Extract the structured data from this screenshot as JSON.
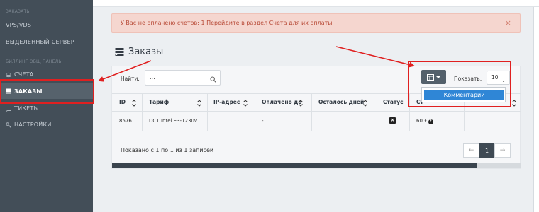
{
  "sidebar": {
    "section_top": "ЗАКАЗАТЬ",
    "vps_label": "VPS/VDS",
    "dedicated_label": "ВЫДЕЛЕННЫЙ СЕРВЕР",
    "section_billing": "БИЛЛИНГ ОБЩ ПАНЕЛЬ",
    "items": [
      {
        "label": "СЧЕТА",
        "icon": "coins-icon"
      },
      {
        "label": "ЗАКАЗЫ",
        "icon": "server-icon",
        "active": true
      },
      {
        "label": "ТИКЕТЫ",
        "icon": "ticket-icon"
      },
      {
        "label": "НАСТРОЙКИ",
        "icon": "wrench-icon"
      }
    ]
  },
  "alert": {
    "text": "У Вас не оплачено счетов: 1 Перейдите в раздел Счета для их оплаты",
    "close": "×"
  },
  "page": {
    "title": "Заказы"
  },
  "toolbar": {
    "search_label": "Найти:",
    "search_value": "...",
    "show_label": "Показать:",
    "page_size": "10",
    "columns_dropdown": [
      "Комментарий"
    ]
  },
  "table": {
    "headers": [
      "ID",
      "Тариф",
      "IP-адрес",
      "Оплачено до",
      "Осталось дней",
      "Статус",
      "Ст"
    ],
    "row": {
      "id": "8576",
      "tariff": "DC1 Intel E3-1230v1",
      "ip": "",
      "paid_until": "-",
      "days_left": "",
      "status": "×",
      "price": "60 £",
      "price_help": "?"
    }
  },
  "footer": {
    "info": "Показано с 1 по 1 из 1 записей",
    "pager_prev": "←",
    "pager_page": "1",
    "pager_next": "→"
  },
  "colors": {
    "sidebar_bg": "#434e58",
    "alert_bg": "#f5d6cf",
    "alert_text": "#b84a37",
    "accent": "#2f86d6",
    "annotation_red": "#e02020"
  }
}
